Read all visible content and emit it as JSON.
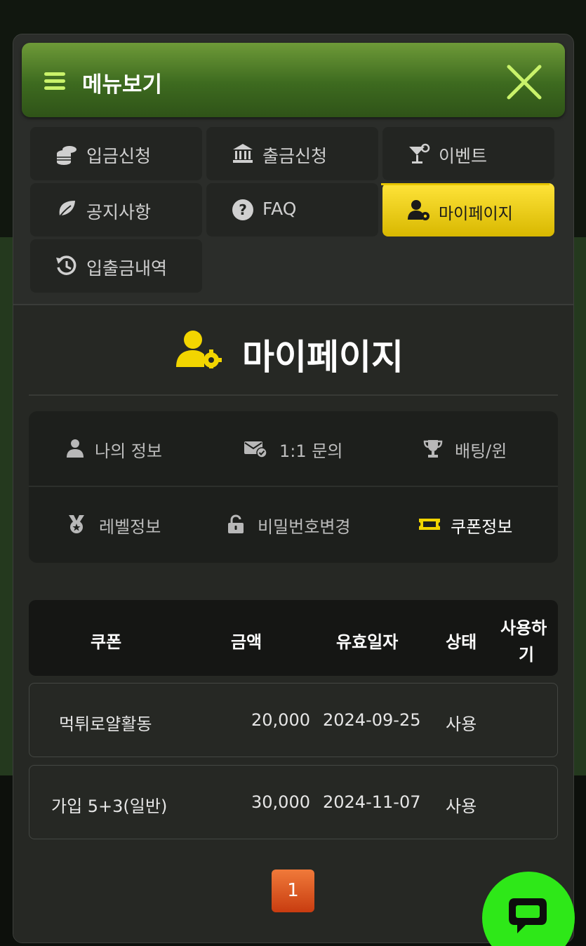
{
  "header": {
    "title": "메뉴보기"
  },
  "menu": [
    {
      "label": "입금신청",
      "icon": "coins-icon"
    },
    {
      "label": "출금신청",
      "icon": "bank-icon"
    },
    {
      "label": "이벤트",
      "icon": "cocktail-icon"
    },
    {
      "label": "공지사항",
      "icon": "leaf-icon"
    },
    {
      "label": "FAQ",
      "icon": "question-icon"
    },
    {
      "label": "마이페이지",
      "icon": "user-gear-icon",
      "active": true
    },
    {
      "label": "입출금내역",
      "icon": "history-icon"
    }
  ],
  "page": {
    "title": "마이페이지"
  },
  "tabs": [
    {
      "label": "나의 정보",
      "icon": "user-icon"
    },
    {
      "label": "1:1 문의",
      "icon": "mail-check-icon"
    },
    {
      "label": "배팅/윈",
      "icon": "trophy-icon"
    },
    {
      "label": "레벨정보",
      "icon": "medal-icon"
    },
    {
      "label": "비밀번호변경",
      "icon": "lock-icon"
    },
    {
      "label": "쿠폰정보",
      "icon": "ticket-icon",
      "active": true
    }
  ],
  "table": {
    "headers": [
      "쿠폰",
      "금액",
      "유효일자",
      "상태",
      "사용하",
      "기"
    ],
    "rows": [
      {
        "coupon": "먹튀로얄활동",
        "amount": "20,000",
        "expiry": "2024-09-25",
        "status": "사용"
      },
      {
        "coupon": "가입 5+3(일반)",
        "amount": "30,000",
        "expiry": "2024-11-07",
        "status": "사용"
      }
    ]
  },
  "pagination": {
    "current": "1"
  },
  "colors": {
    "accent": "#f2d500",
    "header_green": "#4f7e2a",
    "chat": "#2ee818",
    "page_btn": "#e05a20"
  }
}
